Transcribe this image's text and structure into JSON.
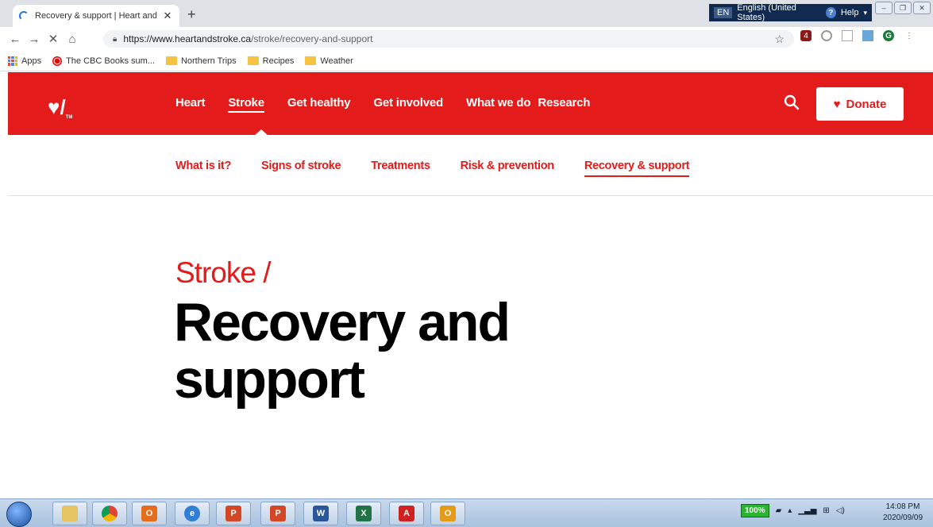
{
  "browser": {
    "tab_title": "Recovery & support | Heart and",
    "tab_close": "✕",
    "new_tab": "+",
    "url_host": "https://www.heartandstroke.ca",
    "url_path": "/stroke/recovery-and-support",
    "nav": {
      "back": "←",
      "forward": "→",
      "stop": "✕",
      "home": "⌂"
    },
    "language_bar": {
      "code": "EN",
      "language": "English (United States)",
      "help": "Help",
      "help_icon": "?",
      "menu": "▾"
    },
    "window_controls": {
      "minimize": "–",
      "restore": "❐",
      "close": "✕"
    },
    "star": "☆",
    "profile_initial": "G",
    "kebab": "⋮",
    "extension_badge": "4"
  },
  "bookmarks": [
    {
      "label": "Apps",
      "icon": "apps-icon"
    },
    {
      "label": "The CBC Books sum...",
      "icon": "cbc-icon"
    },
    {
      "label": "Northern Trips",
      "icon": "folder-icon"
    },
    {
      "label": "Recipes",
      "icon": "folder-icon"
    },
    {
      "label": "Weather",
      "icon": "folder-icon"
    }
  ],
  "site": {
    "logo_text": "♥/",
    "logo_tm": "TM",
    "main_nav": [
      {
        "label": "Heart"
      },
      {
        "label": "Stroke",
        "active": true
      },
      {
        "label": "Get healthy"
      },
      {
        "label": "Get involved"
      },
      {
        "label": "What we do"
      },
      {
        "label": "Research"
      }
    ],
    "donate_label": "Donate",
    "donate_heart": "♥",
    "sub_nav": [
      {
        "label": "What is it?"
      },
      {
        "label": "Signs of stroke"
      },
      {
        "label": "Treatments"
      },
      {
        "label": "Risk & prevention"
      },
      {
        "label": "Recovery & support",
        "active": true
      }
    ],
    "breadcrumb": "Stroke /",
    "heading": "Recovery and support",
    "brand_color": "#e31b1b"
  },
  "taskbar": {
    "apps": [
      "windows-explorer",
      "chrome",
      "outlook",
      "internet-explorer",
      "powerpoint",
      "powerpoint",
      "word",
      "excel",
      "pdf",
      "office-communicator"
    ],
    "app_glyphs": {
      "ppt": "P",
      "word": "W",
      "excel": "X",
      "pdf": "A",
      "oc": "O",
      "outlook": "O",
      "ie": "e"
    },
    "battery": "100%",
    "time": "14:08 PM",
    "date": "2020/09/09"
  }
}
